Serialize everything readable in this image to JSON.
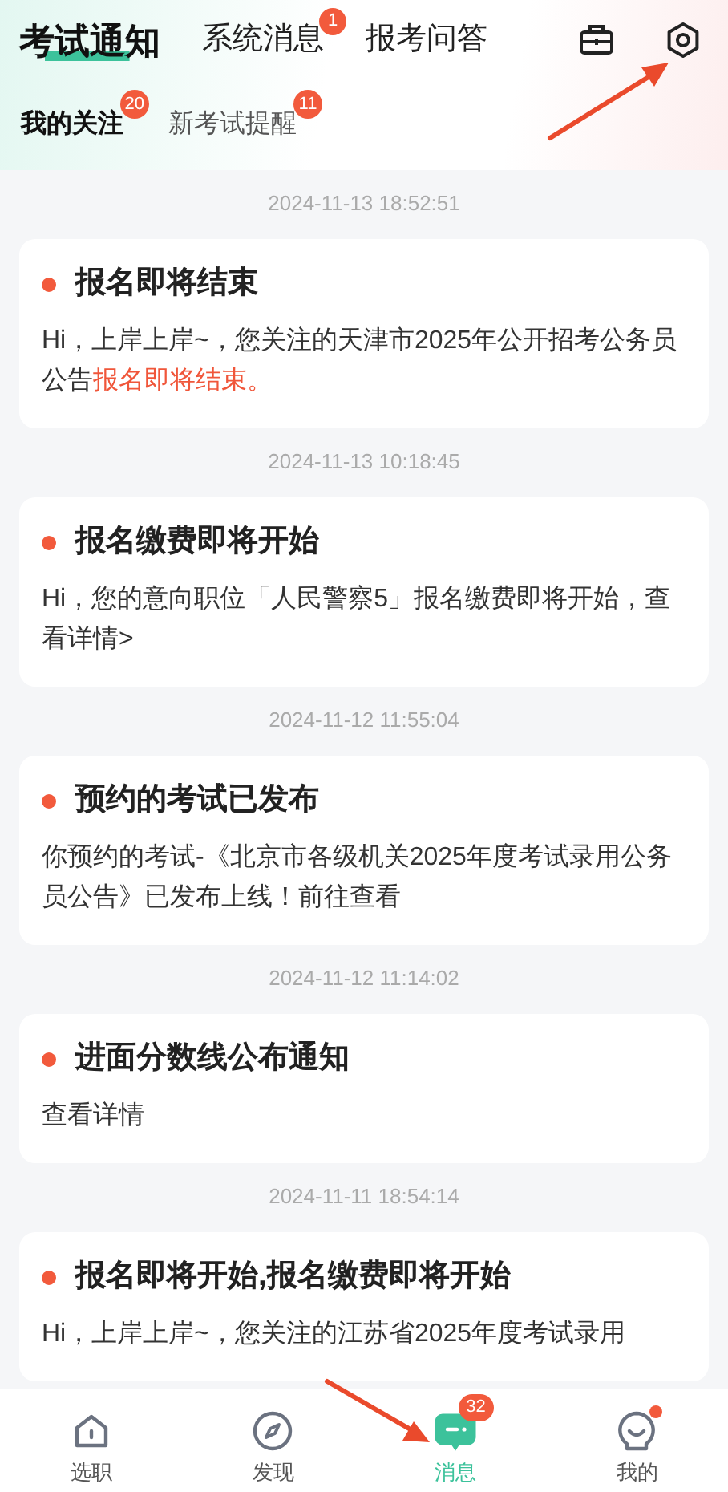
{
  "top_tabs": [
    {
      "label": "考试通知",
      "selected": true
    },
    {
      "label": "系统消息",
      "selected": false,
      "badge": "1"
    },
    {
      "label": "报考问答",
      "selected": false
    }
  ],
  "sub_tabs": [
    {
      "label": "我的关注",
      "selected": true,
      "badge": "20"
    },
    {
      "label": "新考试提醒",
      "selected": false,
      "badge": "11"
    }
  ],
  "messages": [
    {
      "time": "2024-11-13 18:52:51",
      "title": "报名即将结束",
      "unread": true,
      "body": [
        {
          "text": "Hi，上岸上岸~，您关注的天津市2025年公开招考公务员公告",
          "highlight": false
        },
        {
          "text": "报名即将结束。",
          "highlight": true
        }
      ]
    },
    {
      "time": "2024-11-13 10:18:45",
      "title": "报名缴费即将开始",
      "unread": true,
      "body": [
        {
          "text": "Hi，您的意向职位「人民警察5」报名缴费即将开始，查看详情>",
          "highlight": false
        }
      ]
    },
    {
      "time": "2024-11-12 11:55:04",
      "title": "预约的考试已发布",
      "unread": true,
      "body": [
        {
          "text": "你预约的考试-《北京市各级机关2025年度考试录用公务员公告》已发布上线！前往查看",
          "highlight": false
        }
      ]
    },
    {
      "time": "2024-11-12 11:14:02",
      "title": "进面分数线公布通知",
      "unread": true,
      "body": [
        {
          "text": "查看详情",
          "highlight": false
        }
      ]
    },
    {
      "time": "2024-11-11 18:54:14",
      "title": "报名即将开始,报名缴费即将开始",
      "unread": true,
      "body": [
        {
          "text": "Hi，上岸上岸~，您关注的江苏省2025年度考试录用",
          "highlight": false
        }
      ]
    }
  ],
  "tab_bar": [
    {
      "label": "选职",
      "selected": false,
      "kind": "home"
    },
    {
      "label": "发现",
      "selected": false,
      "kind": "compass"
    },
    {
      "label": "消息",
      "selected": true,
      "kind": "chat",
      "badge": "32"
    },
    {
      "label": "我的",
      "selected": false,
      "kind": "face",
      "dot": true
    }
  ]
}
